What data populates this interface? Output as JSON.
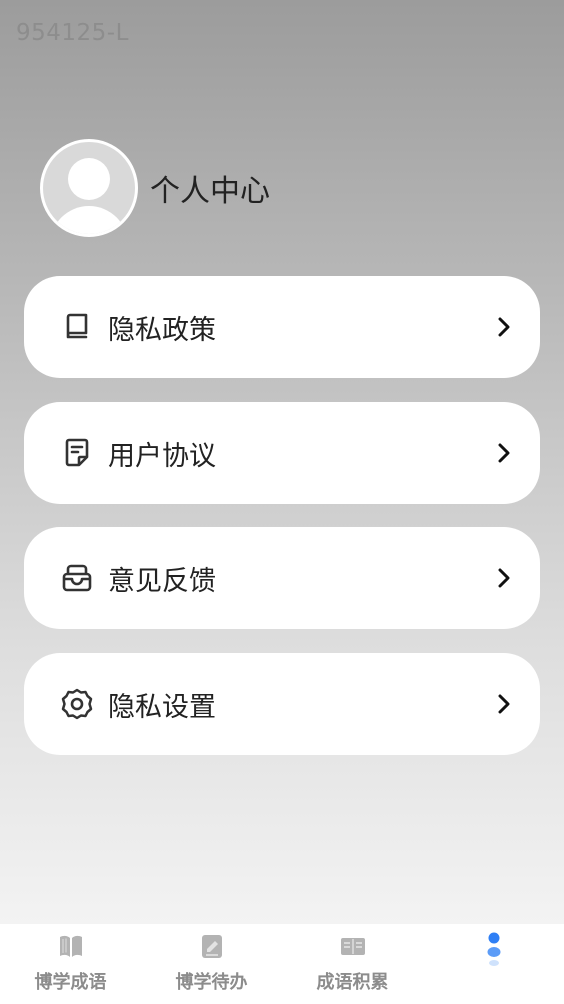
{
  "watermark": "954125-L",
  "profile": {
    "title": "个人中心"
  },
  "menu": [
    {
      "label": "隐私政策",
      "icon": "book-icon"
    },
    {
      "label": "用户协议",
      "icon": "document-icon"
    },
    {
      "label": "意见反馈",
      "icon": "inbox-icon"
    },
    {
      "label": "隐私设置",
      "icon": "gear-icon"
    }
  ],
  "tabs": [
    {
      "label": "博学成语",
      "icon": "book-open-icon"
    },
    {
      "label": "博学待办",
      "icon": "notepad-icon"
    },
    {
      "label": "成语积累",
      "icon": "reader-icon"
    },
    {
      "label": "",
      "icon": "profile-dots-icon",
      "active": true
    }
  ],
  "colors": {
    "accent": "#2f7ff5",
    "text": "#222222",
    "tab_text": "#8c8c8c"
  }
}
